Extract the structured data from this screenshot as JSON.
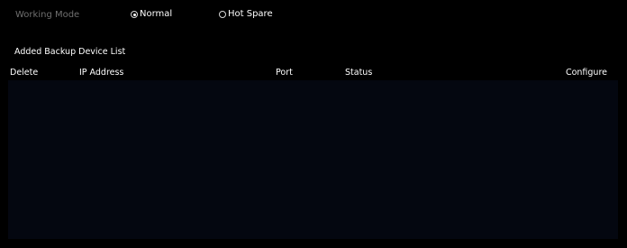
{
  "working_mode": {
    "label": "Working Mode",
    "options": [
      {
        "label": "Normal",
        "selected": true
      },
      {
        "label": "Hot Spare",
        "selected": false
      }
    ]
  },
  "backup_list": {
    "title": "Added Backup Device List",
    "columns": [
      "Delete",
      "IP Address",
      "Port",
      "Status",
      "Configure"
    ],
    "rows": []
  },
  "colors": {
    "background": "#000000",
    "table_body": "#040710",
    "muted_label": "#6f6f6f",
    "text": "#ffffff"
  }
}
